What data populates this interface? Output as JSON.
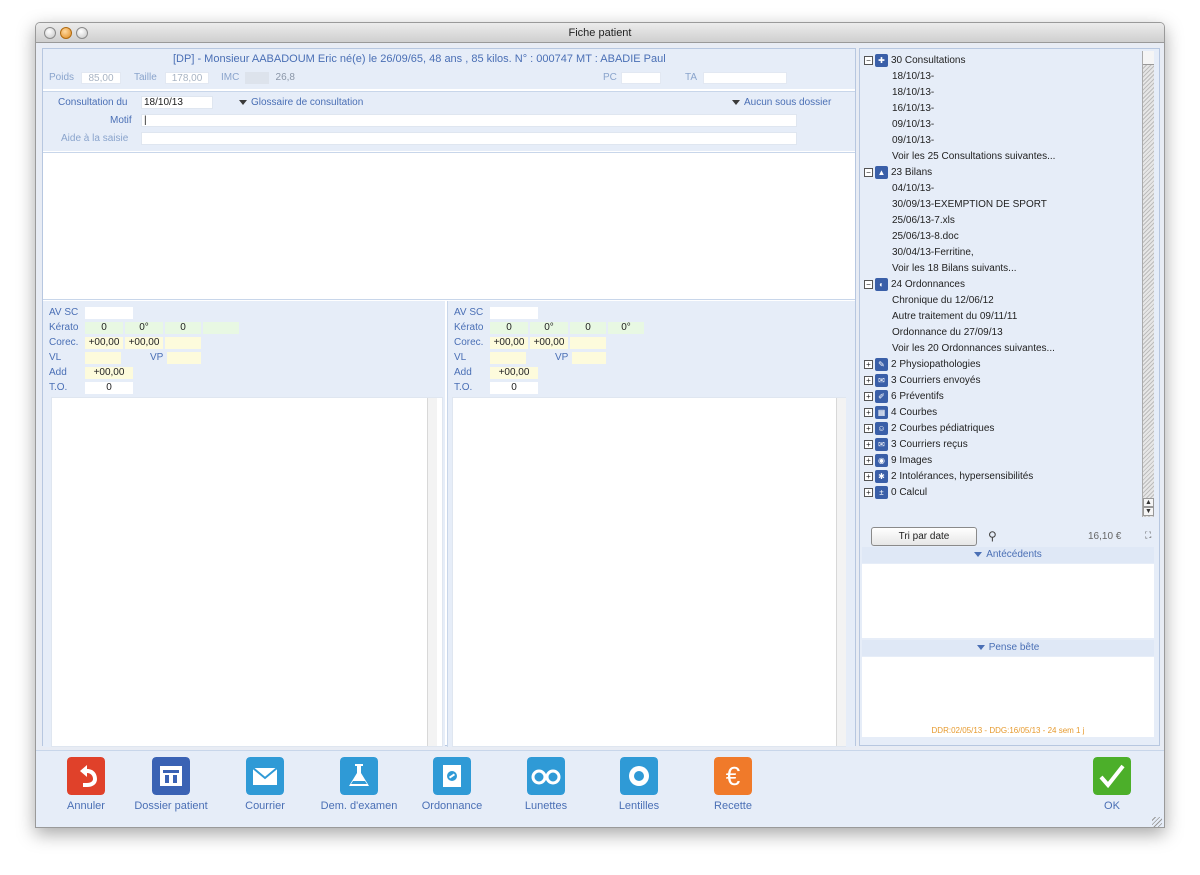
{
  "window": {
    "title": "Fiche patient"
  },
  "patient": {
    "header": "[DP] - Monsieur AABADOUM Eric   né(e) le 26/09/65, 48 ans , 85 kilos.  N° : 000747 MT : ABADIE Paul",
    "poids_label": "Poids",
    "poids_value": "85,00",
    "taille_label": "Taille",
    "taille_value": "178,00",
    "imc_label": "IMC",
    "imc_value": "26,8",
    "pc_label": "PC",
    "pc_value": "",
    "ta_label": "TA",
    "ta_value": ""
  },
  "consultation": {
    "date_label": "Consultation du",
    "date_value": "18/10/13",
    "glossaire": "Glossaire de consultation",
    "sous_dossier": "Aucun sous dossier",
    "motif_label": "Motif",
    "motif_value": "|",
    "aide_label": "Aide à la saisie",
    "aide_value": ""
  },
  "eye_labels": {
    "av_sc": "AV SC",
    "kerato": "Kérato",
    "corec": "Corec.",
    "vl": "VL",
    "vp": "VP",
    "add": "Add",
    "to": "T.O."
  },
  "eye_left": {
    "av_sc": "",
    "kerato": [
      "0",
      "0°",
      "0",
      ""
    ],
    "corec": [
      "+00,00",
      "+00,00",
      ""
    ],
    "vl": "",
    "vp": "",
    "add": "+00,00",
    "to": "0"
  },
  "eye_right": {
    "av_sc": "",
    "kerato": [
      "0",
      "0°",
      "0",
      "0°"
    ],
    "corec": [
      "+00,00",
      "+00,00",
      ""
    ],
    "vl": "",
    "vp": "",
    "add": "+00,00",
    "to": "0"
  },
  "tree": {
    "consultations": {
      "label": "30 Consultations",
      "items": [
        "18/10/13-",
        "18/10/13-",
        "16/10/13-",
        "09/10/13-",
        "09/10/13-",
        "Voir les 25 Consultations suivantes..."
      ]
    },
    "bilans": {
      "label": "23 Bilans",
      "items": [
        "04/10/13-",
        "30/09/13-EXEMPTION DE SPORT",
        "25/06/13-7.xls",
        "25/06/13-8.doc",
        "30/04/13-Ferritine,",
        "Voir les 18 Bilans suivants..."
      ]
    },
    "ordonnances": {
      "label": "24 Ordonnances",
      "items": [
        "Chronique  du 12/06/12",
        "Autre traitement du 09/11/11",
        "Ordonnance du 27/09/13",
        "Voir les 20 Ordonnances suivantes..."
      ]
    },
    "collapsed": [
      "2 Physiopathologies",
      "3 Courriers envoyés",
      "6 Préventifs",
      "4 Courbes",
      "2 Courbes pédiatriques",
      "3 Courriers reçus",
      "9 Images",
      "2 Intolérances, hypersensibilités",
      "0 Calcul"
    ]
  },
  "right_footer": {
    "tri_button": "Tri par date",
    "amount": "16,10 €",
    "antecedents": "Antécédents",
    "pense_bete": "Pense bête",
    "ddr": "DDR:02/05/13 - DDG:16/05/13 - 24 sem 1 j"
  },
  "toolbar": {
    "annuler": "Annuler",
    "dossier": "Dossier patient",
    "courrier": "Courrier",
    "examen": "Dem. d'examen",
    "ordonnance": "Ordonnance",
    "lunettes": "Lunettes",
    "lentilles": "Lentilles",
    "recette": "Recette",
    "ok": "OK"
  },
  "colors": {
    "accent_blue": "#4a6fb5",
    "annuler_red": "#e0412a",
    "recette_orange": "#f07a2a",
    "ok_green": "#4caf2a",
    "ddr_orange": "#e69a2e"
  }
}
